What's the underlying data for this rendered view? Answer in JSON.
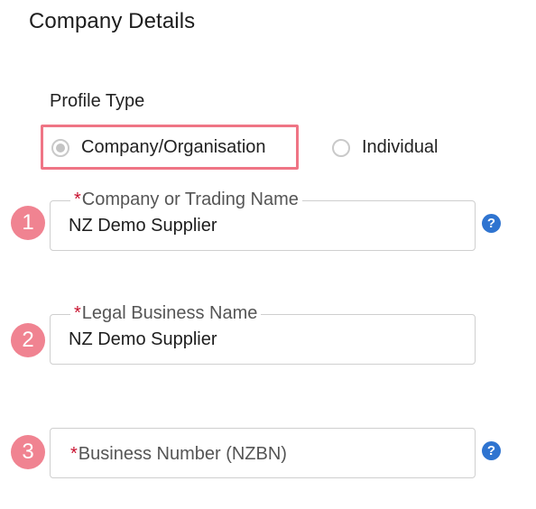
{
  "header": {
    "title": "Company Details"
  },
  "profile_type": {
    "label": "Profile Type",
    "options": [
      {
        "label": "Company/Organisation",
        "selected": true
      },
      {
        "label": "Individual",
        "selected": false
      }
    ]
  },
  "fields": [
    {
      "step": "1",
      "required_mark": "*",
      "label": "Company or Trading Name",
      "value": "NZ Demo Supplier",
      "help_icon": "?"
    },
    {
      "step": "2",
      "required_mark": "*",
      "label": "Legal Business Name",
      "value": "NZ Demo Supplier"
    },
    {
      "step": "3",
      "required_mark": "*",
      "label": "Business Number (NZBN)",
      "value": "",
      "help_icon": "?"
    }
  ],
  "colors": {
    "highlight": "#ef7585",
    "step_badge": "#f08391",
    "required": "#c8102e",
    "help_icon": "#2f74d0"
  }
}
